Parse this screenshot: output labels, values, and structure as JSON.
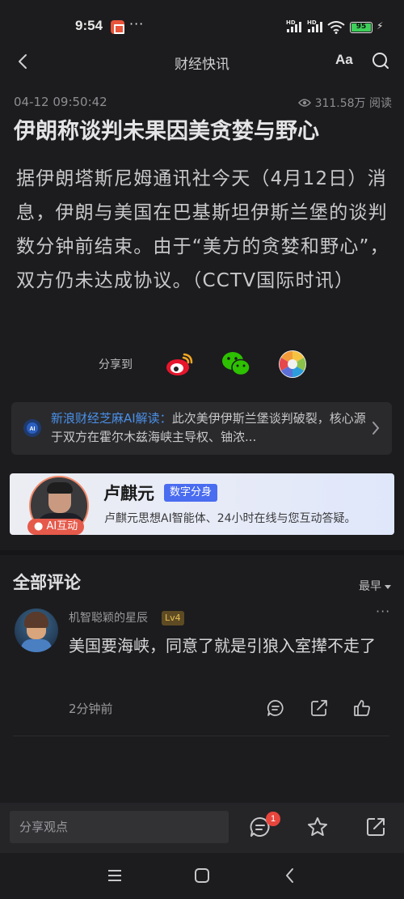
{
  "status_bar": {
    "time": "9:54",
    "dots": "···",
    "battery": "95",
    "hd": "HD"
  },
  "nav": {
    "title": "财经快讯",
    "font_button": "Aa"
  },
  "article": {
    "date": "04-12 09:50:42",
    "views": "311.58万 阅读",
    "title": "伊朗称谈判未果因美贪婪与野心",
    "body": "据伊朗塔斯尼姆通讯社今天（4月12日）消息，伊朗与美国在巴基斯坦伊斯兰堡的谈判数分钟前结束。由于“美方的贪婪和野心”，双方仍未达成协议。（CCTV国际时讯）"
  },
  "share": {
    "label": "分享到",
    "targets": [
      "weibo-icon",
      "wechat-icon",
      "moments-icon"
    ]
  },
  "ai_summary": {
    "label": "新浪财经芝麻AI解读：",
    "text": "此次美伊伊斯兰堡谈判破裂，核心源于双方在霍尔木兹海峡主导权、铀浓..."
  },
  "promo": {
    "name": "卢麒元",
    "tag": "数字分身",
    "desc": "卢麒元思想AI智能体、24小时在线与您互动答疑。",
    "ai_badge": "● AI互动"
  },
  "comments": {
    "title": "全部评论",
    "sort": "最早",
    "items": [
      {
        "user": "机智聪颖的星辰",
        "level": "Lv4",
        "text": "美国要海峡，同意了就是引狼入室撵不走了",
        "time": "2分钟前",
        "more": "···"
      }
    ]
  },
  "bottom_bar": {
    "placeholder": "分享观点",
    "comment_count": "1"
  },
  "colors": {
    "background": "#1c1c1e",
    "accent_blue": "#4a90e8",
    "badge_red": "#e8453c",
    "promo_tag": "#4a6cf0"
  }
}
